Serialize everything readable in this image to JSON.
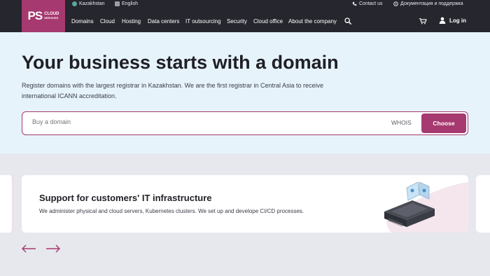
{
  "topbar": {
    "region": "Kazakhstan",
    "language": "English",
    "contact": "Contact us",
    "docs": "Документация и поддержка"
  },
  "logo": {
    "mark": "PS",
    "line1": "CLOUD",
    "line2": "SERVICES"
  },
  "nav": {
    "items": [
      "Domains",
      "Cloud",
      "Hosting",
      "Data centers",
      "IT outsourcing",
      "Security",
      "Cloud office",
      "About the company"
    ],
    "login": "Log in"
  },
  "hero": {
    "title": "Your business starts with a domain",
    "description": "Register domains with the largest registrar in Kazakhstan. We are the first registrar in Central Asia to receive international ICANN accreditation.",
    "search_placeholder": "Buy a domain",
    "whois": "WHOIS",
    "choose": "Choose"
  },
  "slider": {
    "title": "Support for customers' IT infrastructure",
    "description": "We administer physical and cloud servers, Kubernetes clusters. We set up and develope CI/CD processes."
  },
  "colors": {
    "accent": "#a6396f",
    "dark": "#26262e",
    "hero_bg": "#e6f3fb"
  },
  "icons": [
    "globe-icon",
    "language-icon",
    "phone-icon",
    "support-chat-icon",
    "search-icon",
    "cart-icon",
    "user-icon",
    "arrow-left-icon",
    "arrow-right-icon"
  ]
}
